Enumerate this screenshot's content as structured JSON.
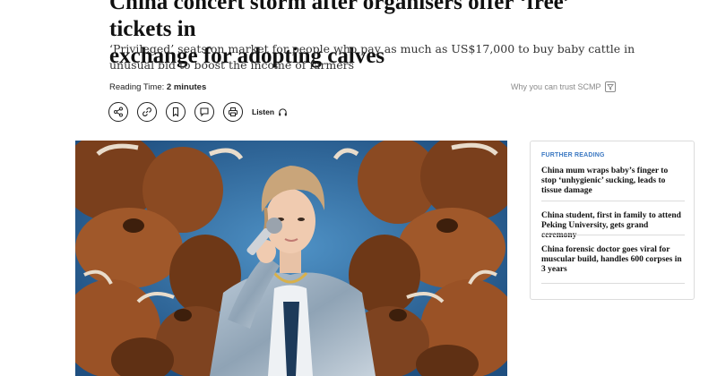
{
  "article": {
    "headline_line1": "China concert storm after organisers offer ‘free’ tickets in",
    "headline_line2": "exchange for adopting calves",
    "subhead": "‘Privileged’ seats on market for people who pay as much as US$17,000 to buy baby cattle in unusual bid to boost the income of farmers",
    "reading_time_label": "Reading Time:",
    "reading_time_value": "2 minutes",
    "trust_link": "Why you can trust SCMP"
  },
  "actions": {
    "share_icon": "share-icon",
    "link_icon": "link-icon",
    "bookmark_icon": "bookmark-icon",
    "comment_icon": "comment-icon",
    "print_icon": "print-icon",
    "listen_label": "Listen",
    "listen_icon": "headphones-icon"
  },
  "sidebar": {
    "label": "FURTHER READING",
    "items": [
      "China mum wraps baby’s finger to stop ‘unhygienic’ sucking, leads to tissue damage",
      "China student, first in family to attend Peking University, gets grand ceremony",
      "China forensic doctor goes viral for muscular build, handles 600 corpses in 3 years"
    ]
  },
  "colors": {
    "accent": "#3b78c2",
    "photo_bg": "#2f6fa3",
    "cattle": "#8b4a22"
  }
}
